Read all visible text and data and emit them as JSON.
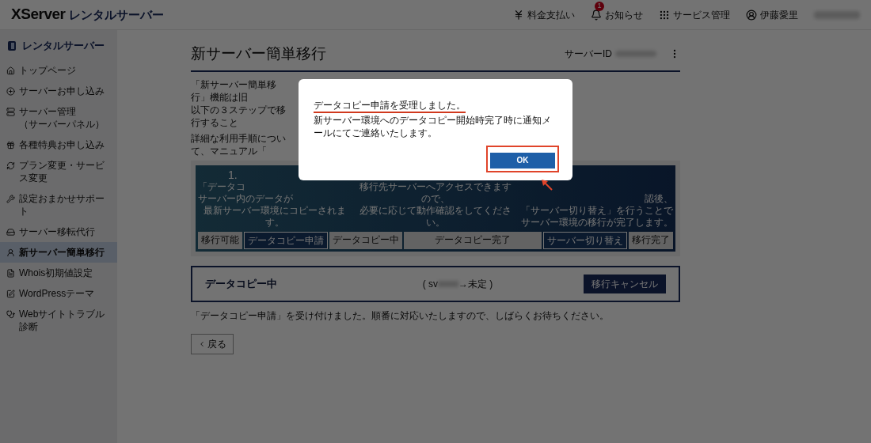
{
  "header": {
    "brand": "XServer",
    "product": "レンタルサーバー",
    "nav": [
      {
        "label": "料金支払い"
      },
      {
        "label": "お知らせ",
        "badge": "1"
      },
      {
        "label": "サービス管理"
      },
      {
        "label": "伊藤愛里"
      }
    ]
  },
  "sidebar": {
    "title": "レンタルサーバー",
    "items": [
      {
        "label": "トップページ",
        "selected": false
      },
      {
        "label": "サーバーお申し込み",
        "selected": false
      },
      {
        "label": "サーバー管理",
        "sublabel": "（サーバーパネル）",
        "selected": false
      },
      {
        "label": "各種特典お申し込み",
        "selected": false
      },
      {
        "label": "プラン変更・サービス変更",
        "selected": false
      },
      {
        "label": "設定おまかせサポート",
        "selected": false
      },
      {
        "label": "サーバー移転代行",
        "selected": false
      },
      {
        "label": "新サーバー簡単移行",
        "selected": true
      },
      {
        "label": "Whois初期値設定",
        "selected": false
      },
      {
        "label": "WordPressテーマ",
        "selected": false
      },
      {
        "label": "Webサイトトラブル診断",
        "selected": false
      }
    ]
  },
  "page": {
    "title": "新サーバー簡単移行",
    "server_id_label": "サーバーID",
    "intro": [
      "「新サーバー簡単移行」機能は旧",
      "以下の３ステップで移行すること"
    ],
    "manual": "詳細な利用手順について、マニュアル「",
    "diagram": {
      "columns": [
        [
          "1.",
          "「データコ",
          "サーバー内のデータが",
          "最新サーバー環境にコピーされます。"
        ],
        [
          "移行先サーバーへアクセスできますので、",
          "必要に応じて動作確認をしてください。"
        ],
        [
          "認後、",
          "「サーバー切り替え」を行うことで",
          "サーバー環境の移行が完了します。"
        ]
      ],
      "steps": [
        {
          "label": "移行可能",
          "highlighted": false
        },
        {
          "label": "データコピー申請",
          "highlighted": true
        },
        {
          "label": "データコピー中",
          "highlighted": false
        },
        {
          "label": "データコピー完了",
          "highlighted": false
        },
        {
          "label": "サーバー切り替え",
          "highlighted": true
        },
        {
          "label": "移行完了",
          "highlighted": false
        }
      ]
    },
    "status_card": {
      "status": "データコピー中",
      "route_prefix": "( sv",
      "route_suffix": "→未定 )",
      "cancel_button": "移行キャンセル"
    },
    "note": "「データコピー申請」を受け付けました。順番に対応いたしますので、しばらくお待ちください。",
    "back_button": "戻る"
  },
  "modal": {
    "heading": "データコピー申請を受理しました。",
    "body": "新サーバー環境へのデータコピー開始時完了時に通知メールにてご連絡いたします。",
    "ok_button": "OK"
  }
}
